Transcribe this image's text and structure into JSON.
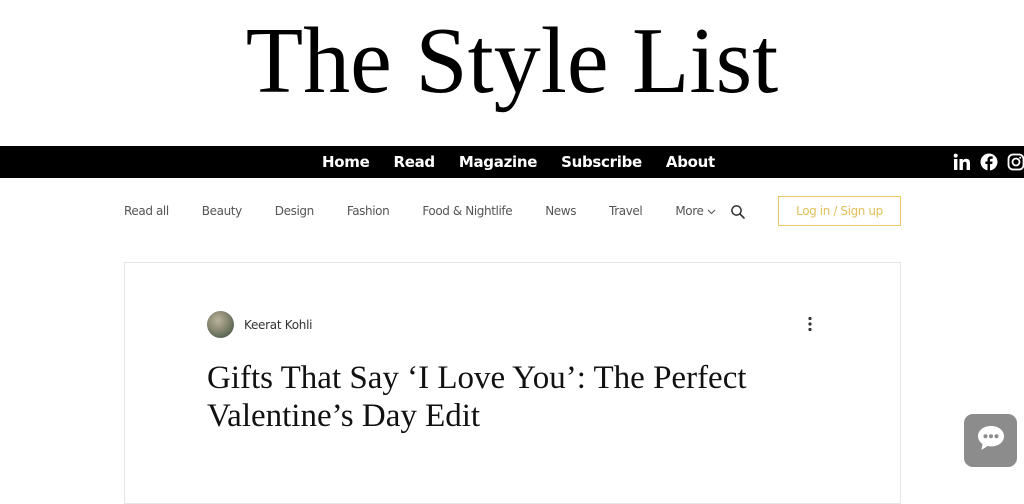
{
  "site": {
    "title": "The Style List"
  },
  "nav": {
    "items": [
      "Home",
      "Read",
      "Magazine",
      "Subscribe",
      "About"
    ]
  },
  "socials": [
    "linkedin-icon",
    "facebook-icon",
    "instagram-icon"
  ],
  "categories": {
    "items": [
      "Read all",
      "Beauty",
      "Design",
      "Fashion",
      "Food & Nightlife",
      "News",
      "Travel",
      "More"
    ],
    "login_label": "Log in / Sign up"
  },
  "post": {
    "author": "Keerat Kohli",
    "title": "Gifts That Say ‘I Love You’: The Perfect Valentine’s Day Edit"
  },
  "colors": {
    "nav_bg": "#000000",
    "accent": "#e0bf5a",
    "chat_bg": "#8c8c8c"
  }
}
